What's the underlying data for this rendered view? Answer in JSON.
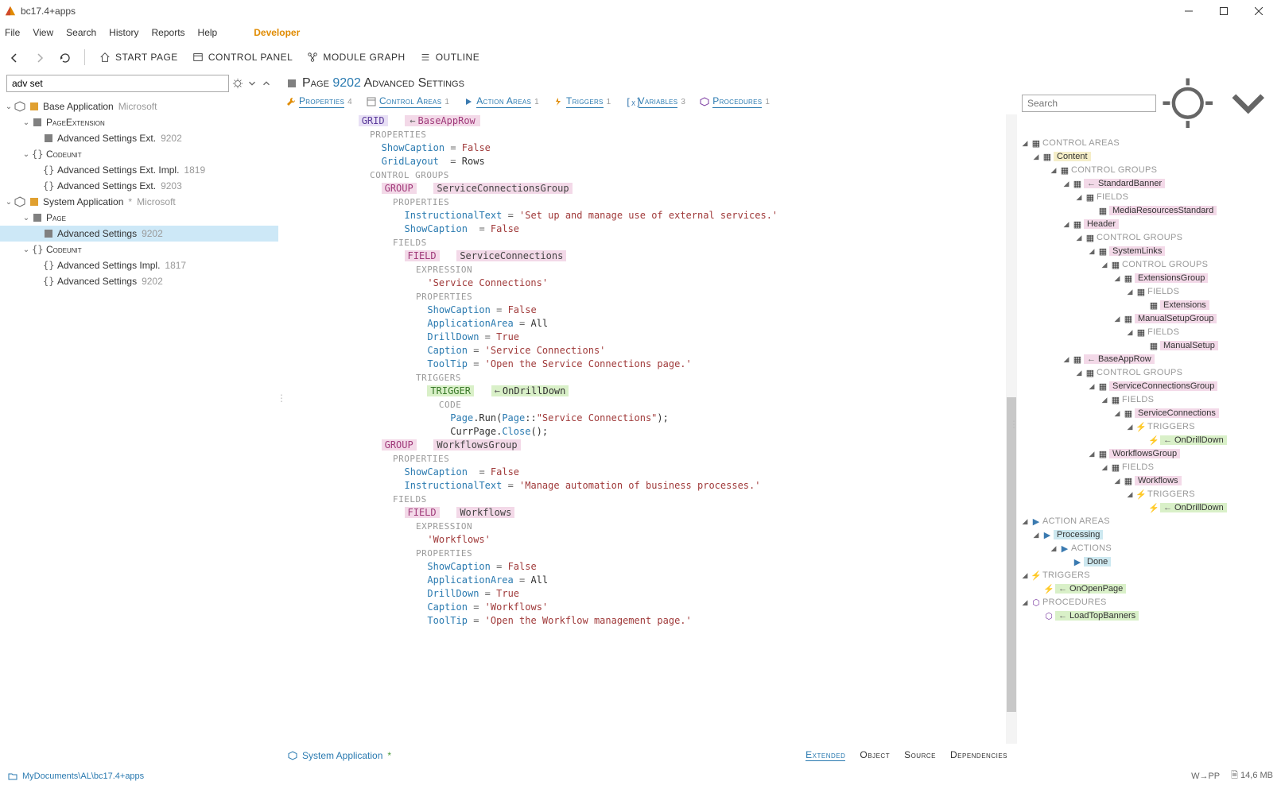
{
  "title": "bc17.4+apps",
  "menu": [
    "File",
    "View",
    "Search",
    "History",
    "Reports",
    "Help"
  ],
  "menu_dev": "Developer",
  "toolbar": {
    "start_page": "START PAGE",
    "control_panel": "CONTROL PANEL",
    "module_graph": "MODULE GRAPH",
    "outline": "OUTLINE"
  },
  "search_value": "adv set",
  "left_tree": {
    "base_app": {
      "label": "Base Application",
      "vendor": "Microsoft"
    },
    "page_ext": "PageExtension",
    "adv_set_ext": {
      "label": "Advanced Settings Ext.",
      "id": "9202"
    },
    "codeunit1": "Codeunit",
    "adv_set_ext_impl": {
      "label": "Advanced Settings Ext. Impl.",
      "id": "1819"
    },
    "adv_set_ext2": {
      "label": "Advanced Settings Ext.",
      "id": "9203"
    },
    "sys_app": {
      "label": "System Application",
      "vendor": "Microsoft"
    },
    "page": "Page",
    "adv_set": {
      "label": "Advanced Settings",
      "id": "9202"
    },
    "codeunit2": "Codeunit",
    "adv_set_impl": {
      "label": "Advanced Settings Impl.",
      "id": "1817"
    },
    "adv_set2": {
      "label": "Advanced Settings",
      "id": "9202"
    }
  },
  "page_header": {
    "kind": "Page",
    "num": "9202",
    "name": "Advanced Settings"
  },
  "tabs": {
    "properties": {
      "label": "Properties",
      "cnt": "4"
    },
    "control_areas": {
      "label": "Control Areas",
      "cnt": "1"
    },
    "action_areas": {
      "label": "Action Areas",
      "cnt": "1"
    },
    "triggers": {
      "label": "Triggers",
      "cnt": "1"
    },
    "variables": {
      "label": "Variables",
      "cnt": "3"
    },
    "procedures": {
      "label": "Procedures",
      "cnt": "1"
    }
  },
  "code": {
    "grid": "GRID",
    "baseapprow": "BaseAppRow",
    "PROPERTIES": "PROPERTIES",
    "CONTROL_GROUPS": "CONTROL GROUPS",
    "FIELDS": "FIELDS",
    "EXPRESSION": "EXPRESSION",
    "TRIGGERS": "TRIGGERS",
    "CODE": "CODE",
    "ShowCaption": "ShowCaption",
    "GridLayout": "GridLayout",
    "InstructionalText": "InstructionalText",
    "ApplicationArea": "ApplicationArea",
    "DrillDown": "DrillDown",
    "Caption": "Caption",
    "ToolTip": "ToolTip",
    "False": "False",
    "True": "True",
    "Rows": "Rows",
    "All": "All",
    "GROUP": "GROUP",
    "FIELD": "FIELD",
    "TRIGGER": "TRIGGER",
    "ServiceConnectionsGroup": "ServiceConnectionsGroup",
    "ServiceConnections": "ServiceConnections",
    "inst1": "'Set up and manage use of external services.'",
    "expr1": "'Service Connections'",
    "cap1": "'Service Connections'",
    "tip1": "'Open the Service Connections page.'",
    "OnDrillDown": "OnDrillDown",
    "codeln1a": "Page",
    "codeln1b": ".Run(",
    "codeln1c": "Page",
    "codeln1d": "::",
    "codeln1e": "\"Service Connections\"",
    "codeln1f": ");",
    "codeln2a": "CurrPage.",
    "codeln2b": "Close",
    "codeln2c": "();",
    "WorkflowsGroup": "WorkflowsGroup",
    "Workflows": "Workflows",
    "inst2": "'Manage automation of business processes.'",
    "expr2": "'Workflows'",
    "cap2": "'Workflows'",
    "tip2": "'Open the Workflow management page.'"
  },
  "footer": {
    "app": "System Application",
    "extended": "Extended",
    "object": "Object",
    "source": "Source",
    "deps": "Dependencies"
  },
  "right": {
    "search_ph": "Search",
    "CONTROL_AREAS": "CONTROL AREAS",
    "Content": "Content",
    "CONTROL_GROUPS": "CONTROL GROUPS",
    "FIELDS": "FIELDS",
    "TRIGGERS": "TRIGGERS",
    "ACTIONS": "ACTIONS",
    "ACTION_AREAS": "ACTION AREAS",
    "PROCEDURES": "PROCEDURES",
    "StandardBanner": "StandardBanner",
    "MediaResourcesStandard": "MediaResourcesStandard",
    "Header": "Header",
    "SystemLinks": "SystemLinks",
    "ExtensionsGroup": "ExtensionsGroup",
    "Extensions": "Extensions",
    "ManualSetupGroup": "ManualSetupGroup",
    "ManualSetup": "ManualSetup",
    "BaseAppRow": "BaseAppRow",
    "ServiceConnectionsGroup": "ServiceConnectionsGroup",
    "ServiceConnections": "ServiceConnections",
    "OnDrillDown": "OnDrillDown",
    "WorkflowsGroup": "WorkflowsGroup",
    "Workflows": "Workflows",
    "Processing": "Processing",
    "Done": "Done",
    "OnOpenPage": "OnOpenPage",
    "LoadTopBanners": "LoadTopBanners"
  },
  "status": {
    "path": "MyDocuments\\AL\\bc17.4+apps",
    "wpp": "W→PP",
    "mem": "14,6 MB"
  }
}
